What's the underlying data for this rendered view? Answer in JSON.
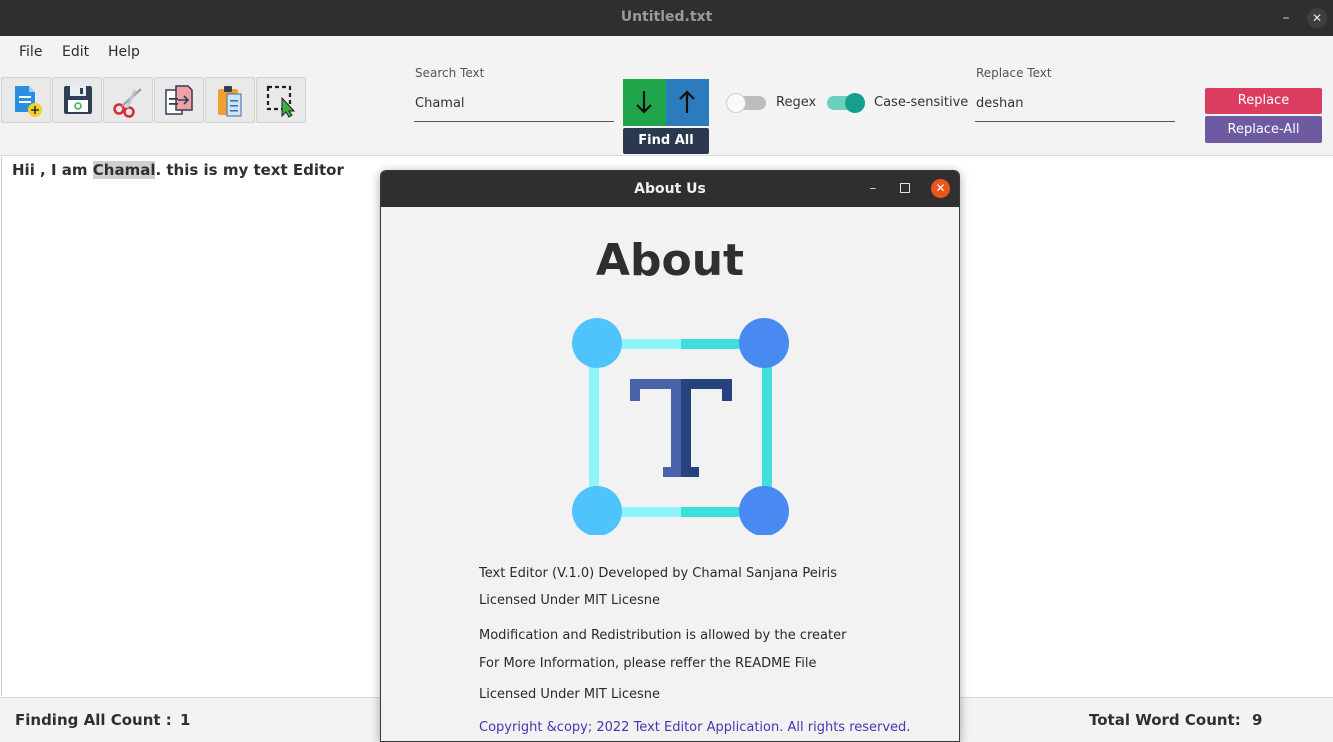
{
  "window": {
    "title": "Untitled.txt",
    "minimize": "–",
    "close": "✕"
  },
  "menu": {
    "items": [
      "File",
      "Edit",
      "Help"
    ]
  },
  "toolbar": {
    "icons": [
      "new-file-icon",
      "save-icon",
      "cut-icon",
      "copy-icon",
      "paste-icon",
      "select-all-icon"
    ]
  },
  "search": {
    "label": "Search Text",
    "value": "Chamal"
  },
  "find": {
    "down_icon": "arrow-down-icon",
    "up_icon": "arrow-up-icon",
    "find_all_label": "Find All"
  },
  "toggles": {
    "regex": {
      "label": "Regex",
      "on": false
    },
    "case_sensitive": {
      "label": "Case-sensitive",
      "on": true
    }
  },
  "replace": {
    "label": "Replace Text",
    "value": "deshan",
    "replace_label": "Replace",
    "replace_all_label": "Replace-All"
  },
  "editor": {
    "before": "Hii , I am ",
    "highlight": "Chamal",
    "after": ". this is my text Editor"
  },
  "status": {
    "finding_label": "Finding All Count :",
    "finding_count": "1",
    "word_count_label": "Total Word Count:",
    "word_count": "9"
  },
  "about_dialog": {
    "title": "About Us",
    "heading": "About",
    "lines": [
      "Text Editor (V.1.0) Developed by Chamal Sanjana Peiris",
      "Licensed Under MIT Licesne",
      "Modification and Redistribution is allowed by the creater",
      "For More Information, please reffer the README File",
      "Licensed Under MIT Licesne"
    ],
    "copyright": "Copyright &copy; 2022 Text Editor Application. All rights reserved.",
    "logo_icon": "text-editor-logo-icon"
  },
  "colors": {
    "titlebar": "#2f2f2f",
    "find_down": "#1fa64a",
    "find_up": "#2b7bbd",
    "find_all": "#2b3950",
    "toggle_on": "#179f8d",
    "replace": "#db3c60",
    "replace_all": "#6e5aa0",
    "dialog_close": "#e9541f",
    "copyright": "#4a34b6"
  }
}
